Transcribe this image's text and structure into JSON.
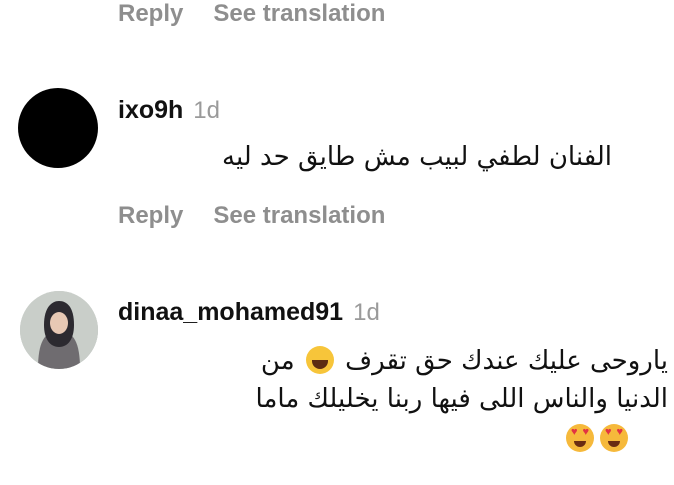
{
  "comments": [
    {
      "actions": {
        "reply_label": "Reply",
        "translate_label": "See translation"
      }
    },
    {
      "username": "ixo9h",
      "time": "1d",
      "text": "الفنان لطفي لبيب مش طايق حد ليه",
      "actions": {
        "reply_label": "Reply",
        "translate_label": "See translation"
      }
    },
    {
      "username": "dinaa_mohamed91",
      "time": "1d",
      "text_line1": "ياروحى عليك عندك حق تقرف",
      "text_line1_emoji": "😂",
      "text_line1_end": "من",
      "text_line2": "الدنيا والناس اللى فيها ربنا يخليلك ماما",
      "text_line3_emojis": [
        "😍",
        "😍"
      ]
    }
  ]
}
